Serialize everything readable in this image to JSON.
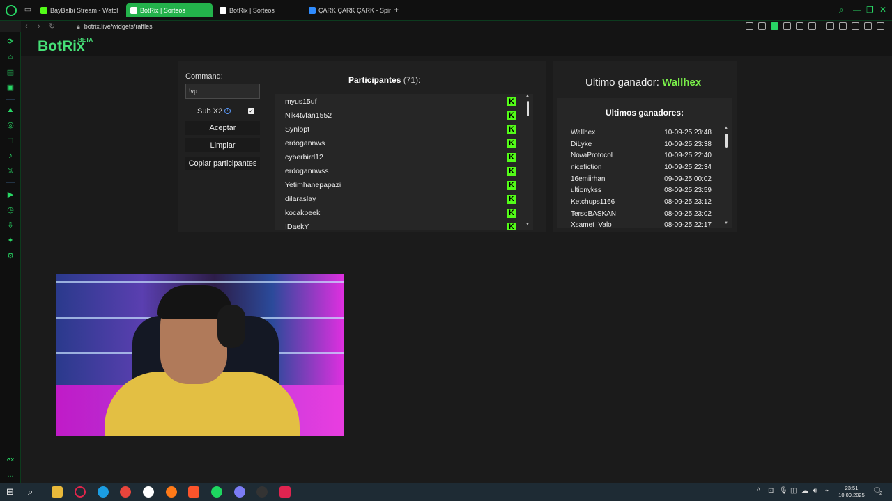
{
  "browser": {
    "tabs": [
      {
        "label": "BayBalbi Stream - Watch",
        "favicon_color": "#53fc18"
      },
      {
        "label": "BotRix | Sorteos",
        "favicon_color": "#ffffff",
        "active": true
      },
      {
        "label": "BotRix | Sorteos",
        "favicon_color": "#ffffff"
      },
      {
        "label": "ÇARK ÇARK ÇARK - Spin",
        "favicon_color": "#2f8cff"
      }
    ],
    "new_tab": "+",
    "url": "botrix.live/widgets/raffles"
  },
  "site": {
    "brand": "BotRix",
    "brand_badge": "BETA"
  },
  "raffle": {
    "command_label": "Command:",
    "command_value": "!vp",
    "sub_label": "Sub X2",
    "sub_checked": true,
    "buttons": {
      "accept": "Aceptar",
      "clear": "Limpiar",
      "copy": "Copiar participantes"
    },
    "participants_title": "Participantes",
    "participants_count": "(71):",
    "participants": [
      "myus15uf",
      "Nik4tvfan1552",
      "Synlopt",
      "erdogannws",
      "cyberbird12",
      "erdogannwss",
      "Yetimhanepapazi",
      "dilaraslay",
      "kocakpeek",
      "IDaekY"
    ]
  },
  "winners": {
    "last_winner_label": "Ultimo ganador:",
    "last_winner_name": "Wallhex",
    "list_title": "Ultimos ganadores:",
    "list": [
      {
        "name": "Wallhex",
        "date": "10-09-25 23:48"
      },
      {
        "name": "DiLyke",
        "date": "10-09-25 23:38"
      },
      {
        "name": "NovaProtocol",
        "date": "10-09-25 22:40"
      },
      {
        "name": "nicefiction",
        "date": "10-09-25 22:34"
      },
      {
        "name": "16emiirhan",
        "date": "09-09-25 00:02"
      },
      {
        "name": "ultionykss",
        "date": "08-09-25 23:59"
      },
      {
        "name": "Ketchups1166",
        "date": "08-09-25 23:12"
      },
      {
        "name": "TersoBASKAN",
        "date": "08-09-25 23:02"
      },
      {
        "name": "Xsamet_Valo",
        "date": "08-09-25 22:17"
      }
    ]
  },
  "sidebar": {
    "bottom_label": "GX",
    "more": "..."
  },
  "taskbar": {
    "time": "23:51",
    "date": "10.09.2025",
    "notifications": "2"
  },
  "colors": {
    "accent": "#28d765",
    "kick_green": "#53fc18",
    "winner_name": "#7bf24a"
  }
}
